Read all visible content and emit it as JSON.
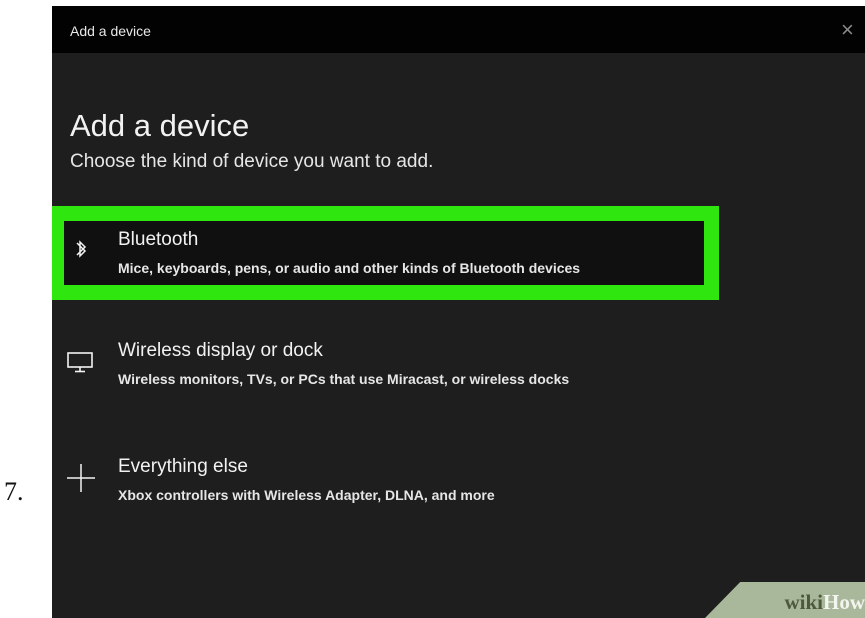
{
  "step": {
    "number": "7."
  },
  "window": {
    "title": "Add a device",
    "heading": "Add a device",
    "subtitle": "Choose the kind of device you want to add.",
    "close_icon": "close-icon"
  },
  "options": [
    {
      "title": "Bluetooth",
      "description": "Mice, keyboards, pens, or audio and other kinds of Bluetooth devices",
      "icon": "bluetooth-icon",
      "selected": true
    },
    {
      "title": "Wireless display or dock",
      "description": "Wireless monitors, TVs, or PCs that use Miracast, or wireless docks",
      "icon": "monitor-icon",
      "selected": false
    },
    {
      "title": "Everything else",
      "description": "Xbox controllers with Wireless Adapter, DLNA, and more",
      "icon": "plus-icon",
      "selected": false
    }
  ],
  "watermark": {
    "brand_prefix": "wiki",
    "brand_suffix": "How"
  },
  "colors": {
    "window_background": "#1e1e1e",
    "titlebar_background": "#020202",
    "highlight": "#2fe60f",
    "text": "#f2f2f2"
  }
}
